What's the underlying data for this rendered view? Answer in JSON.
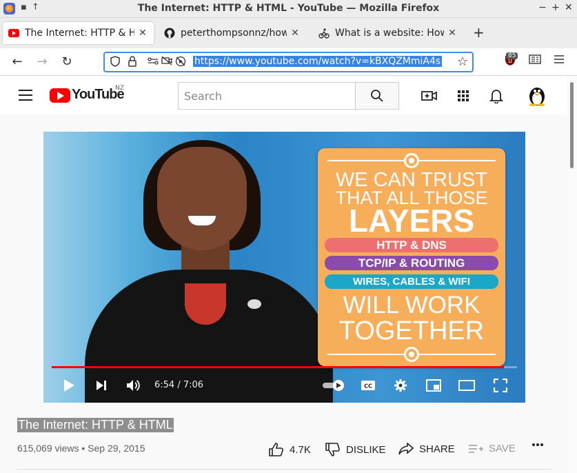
{
  "window": {
    "title": "The Internet: HTTP & HTML - YouTube — Mozilla Firefox"
  },
  "tabs": [
    {
      "label": "The Internet: HTTP & HTML",
      "icon": "youtube-icon",
      "active": true
    },
    {
      "label": "peterthompsonnz/howstuff",
      "icon": "github-icon",
      "active": false
    },
    {
      "label": "What is a website: How S",
      "icon": "cyclist-icon",
      "active": false
    }
  ],
  "navbar": {
    "url": "https://www.youtube.com/watch?v=kBXQZMmiA4s",
    "extension_badge": "85"
  },
  "youtube": {
    "logo_text": "YouTube",
    "region": "NZ",
    "search_placeholder": "Search"
  },
  "video": {
    "card": {
      "line1": "WE CAN TRUST",
      "line2": "THAT ALL THOSE",
      "line3": "LAYERS",
      "pills": [
        {
          "text": "HTTP & DNS",
          "color": "#ee6f6f"
        },
        {
          "text": "TCP/IP & ROUTING",
          "color": "#8a4bab"
        },
        {
          "text": "WIRES, CABLES & WIFI",
          "color": "#1aa7c8"
        }
      ],
      "line4": "WILL WORK",
      "line5": "TOGETHER"
    },
    "time_display": "6:54 / 7:06",
    "progress_fraction": 0.972
  },
  "details": {
    "title": "The Internet: HTTP & HTML",
    "meta": "615,069 views • Sep 29, 2015",
    "like_count": "4.7K",
    "dislike_label": "DISLIKE",
    "share_label": "SHARE",
    "save_label": "SAVE"
  },
  "colors": {
    "accent_red": "#ff0000",
    "url_highlight": "#3584e4",
    "card_orange": "#f7ae5b"
  }
}
